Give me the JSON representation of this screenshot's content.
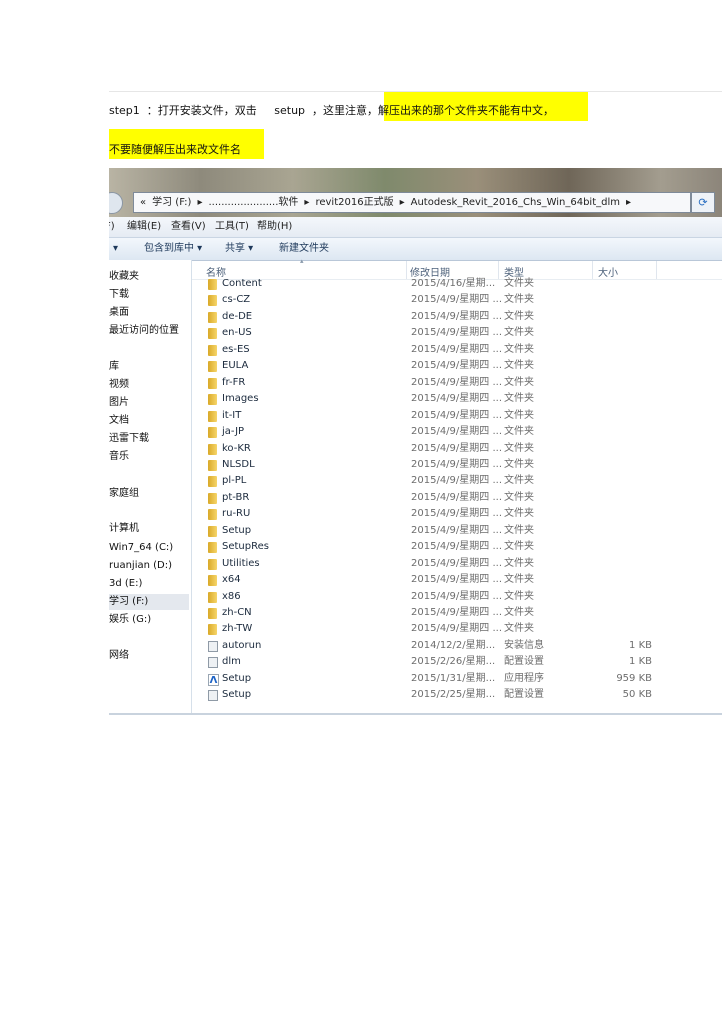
{
  "text": {
    "line1_a": "step1  ：打开安装文件，双击     setup  ，这里注意，解",
    "line1_b": "压出来的那个文件夹不能有中文，",
    "line2": "不要随便解压出来改文件名"
  },
  "highlight_color": "#ffff00",
  "explorer": {
    "address": [
      "«",
      "学习 (F:)",
      "▸",
      "......................软件",
      "▸",
      "revit2016正式版",
      "▸",
      "Autodesk_Revit_2016_Chs_Win_64bit_dlm",
      "▸"
    ],
    "refresh_icon": "refresh-icon",
    "menu": [
      "F)",
      "编辑(E)",
      "查看(V)",
      "工具(T)",
      "帮助(H)"
    ],
    "toolbar": [
      "▾",
      "包含到库中 ▾",
      "共享 ▾",
      "新建文件夹"
    ],
    "columns": {
      "name": "名称",
      "date": "修改日期",
      "type": "类型",
      "size": "大小"
    },
    "sidebar": [
      {
        "label": "收藏夹"
      },
      {
        "label": "下载"
      },
      {
        "label": "桌面"
      },
      {
        "label": "最近访问的位置"
      },
      {
        "label": "库"
      },
      {
        "label": "视频"
      },
      {
        "label": "图片"
      },
      {
        "label": "文档"
      },
      {
        "label": "迅雷下载"
      },
      {
        "label": "音乐"
      },
      {
        "label": "家庭组"
      },
      {
        "label": "计算机"
      },
      {
        "label": "Win7_64 (C:)"
      },
      {
        "label": "ruanjian (D:)"
      },
      {
        "label": "3d (E:)"
      },
      {
        "label": "学习 (F:)",
        "selected": true
      },
      {
        "label": "娱乐 (G:)"
      },
      {
        "label": "网络"
      }
    ],
    "files": [
      {
        "name": "Content",
        "date": "2015/4/16/星期...",
        "type": "文件夹",
        "size": "",
        "icon": "folder"
      },
      {
        "name": "cs-CZ",
        "date": "2015/4/9/星期四 ...",
        "type": "文件夹",
        "size": "",
        "icon": "folder"
      },
      {
        "name": "de-DE",
        "date": "2015/4/9/星期四 ...",
        "type": "文件夹",
        "size": "",
        "icon": "folder"
      },
      {
        "name": "en-US",
        "date": "2015/4/9/星期四 ...",
        "type": "文件夹",
        "size": "",
        "icon": "folder"
      },
      {
        "name": "es-ES",
        "date": "2015/4/9/星期四 ...",
        "type": "文件夹",
        "size": "",
        "icon": "folder"
      },
      {
        "name": "EULA",
        "date": "2015/4/9/星期四 ...",
        "type": "文件夹",
        "size": "",
        "icon": "folder"
      },
      {
        "name": "fr-FR",
        "date": "2015/4/9/星期四 ...",
        "type": "文件夹",
        "size": "",
        "icon": "folder"
      },
      {
        "name": "Images",
        "date": "2015/4/9/星期四 ...",
        "type": "文件夹",
        "size": "",
        "icon": "folder"
      },
      {
        "name": "it-IT",
        "date": "2015/4/9/星期四 ...",
        "type": "文件夹",
        "size": "",
        "icon": "folder"
      },
      {
        "name": "ja-JP",
        "date": "2015/4/9/星期四 ...",
        "type": "文件夹",
        "size": "",
        "icon": "folder"
      },
      {
        "name": "ko-KR",
        "date": "2015/4/9/星期四 ...",
        "type": "文件夹",
        "size": "",
        "icon": "folder"
      },
      {
        "name": "NLSDL",
        "date": "2015/4/9/星期四 ...",
        "type": "文件夹",
        "size": "",
        "icon": "folder"
      },
      {
        "name": "pl-PL",
        "date": "2015/4/9/星期四 ...",
        "type": "文件夹",
        "size": "",
        "icon": "folder"
      },
      {
        "name": "pt-BR",
        "date": "2015/4/9/星期四 ...",
        "type": "文件夹",
        "size": "",
        "icon": "folder"
      },
      {
        "name": "ru-RU",
        "date": "2015/4/9/星期四 ...",
        "type": "文件夹",
        "size": "",
        "icon": "folder"
      },
      {
        "name": "Setup",
        "date": "2015/4/9/星期四 ...",
        "type": "文件夹",
        "size": "",
        "icon": "folder"
      },
      {
        "name": "SetupRes",
        "date": "2015/4/9/星期四 ...",
        "type": "文件夹",
        "size": "",
        "icon": "folder"
      },
      {
        "name": "Utilities",
        "date": "2015/4/9/星期四 ...",
        "type": "文件夹",
        "size": "",
        "icon": "folder"
      },
      {
        "name": "x64",
        "date": "2015/4/9/星期四 ...",
        "type": "文件夹",
        "size": "",
        "icon": "folder"
      },
      {
        "name": "x86",
        "date": "2015/4/9/星期四 ...",
        "type": "文件夹",
        "size": "",
        "icon": "folder"
      },
      {
        "name": "zh-CN",
        "date": "2015/4/9/星期四 ...",
        "type": "文件夹",
        "size": "",
        "icon": "folder"
      },
      {
        "name": "zh-TW",
        "date": "2015/4/9/星期四 ...",
        "type": "文件夹",
        "size": "",
        "icon": "folder"
      },
      {
        "name": "autorun",
        "date": "2014/12/2/星期...",
        "type": "安装信息",
        "size": "1 KB",
        "icon": "cfg"
      },
      {
        "name": "dlm",
        "date": "2015/2/26/星期...",
        "type": "配置设置",
        "size": "1 KB",
        "icon": "cfg"
      },
      {
        "name": "Setup",
        "date": "2015/1/31/星期...",
        "type": "应用程序",
        "size": "959 KB",
        "icon": "app"
      },
      {
        "name": "Setup",
        "date": "2015/2/25/星期...",
        "type": "配置设置",
        "size": "50 KB",
        "icon": "cfg"
      }
    ]
  }
}
